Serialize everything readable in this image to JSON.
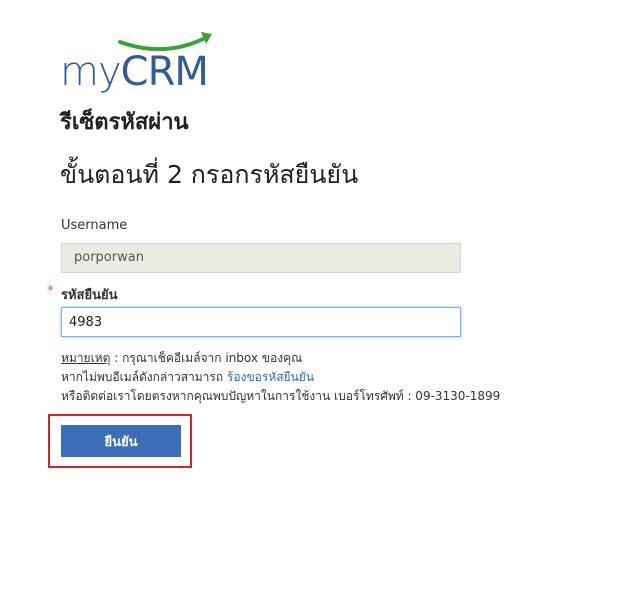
{
  "brand": {
    "logo_my": "my",
    "logo_crm": "CRM",
    "swoosh_color": "#3aa335",
    "text_color": "#2f5c9c"
  },
  "page_title": "รีเซ็ตรหัสผ่าน",
  "step_title": "ขั้นตอนที่ 2 กรอกรหัสยืนยัน",
  "form": {
    "username_label": "Username",
    "username_value": "porporwan",
    "required_mark": "*",
    "otp_label": "รหัสยืนยัน",
    "otp_value": "4983"
  },
  "notes": {
    "note_prefix": "หมายเหตุ",
    "line1_rest": " : กรุณาเช็คอีเมล์จาก inbox ของคุณ",
    "line2_text": "หากไม่พบอีเมล์ดังกล่าวสามารถ ",
    "line2_link": "ร้องขอรหัสยืนยัน",
    "line3_text": "หรือติดต่อเราโดยตรงหากคุณพบปัญหาในการใช้งาน เบอร์โทรศัพท์ : 09-3130-1899"
  },
  "confirm_button": "ยืนยัน",
  "colors": {
    "button_bg": "#3a6fb7",
    "highlight_border": "#d9232a",
    "link": "#2b6cb0"
  }
}
